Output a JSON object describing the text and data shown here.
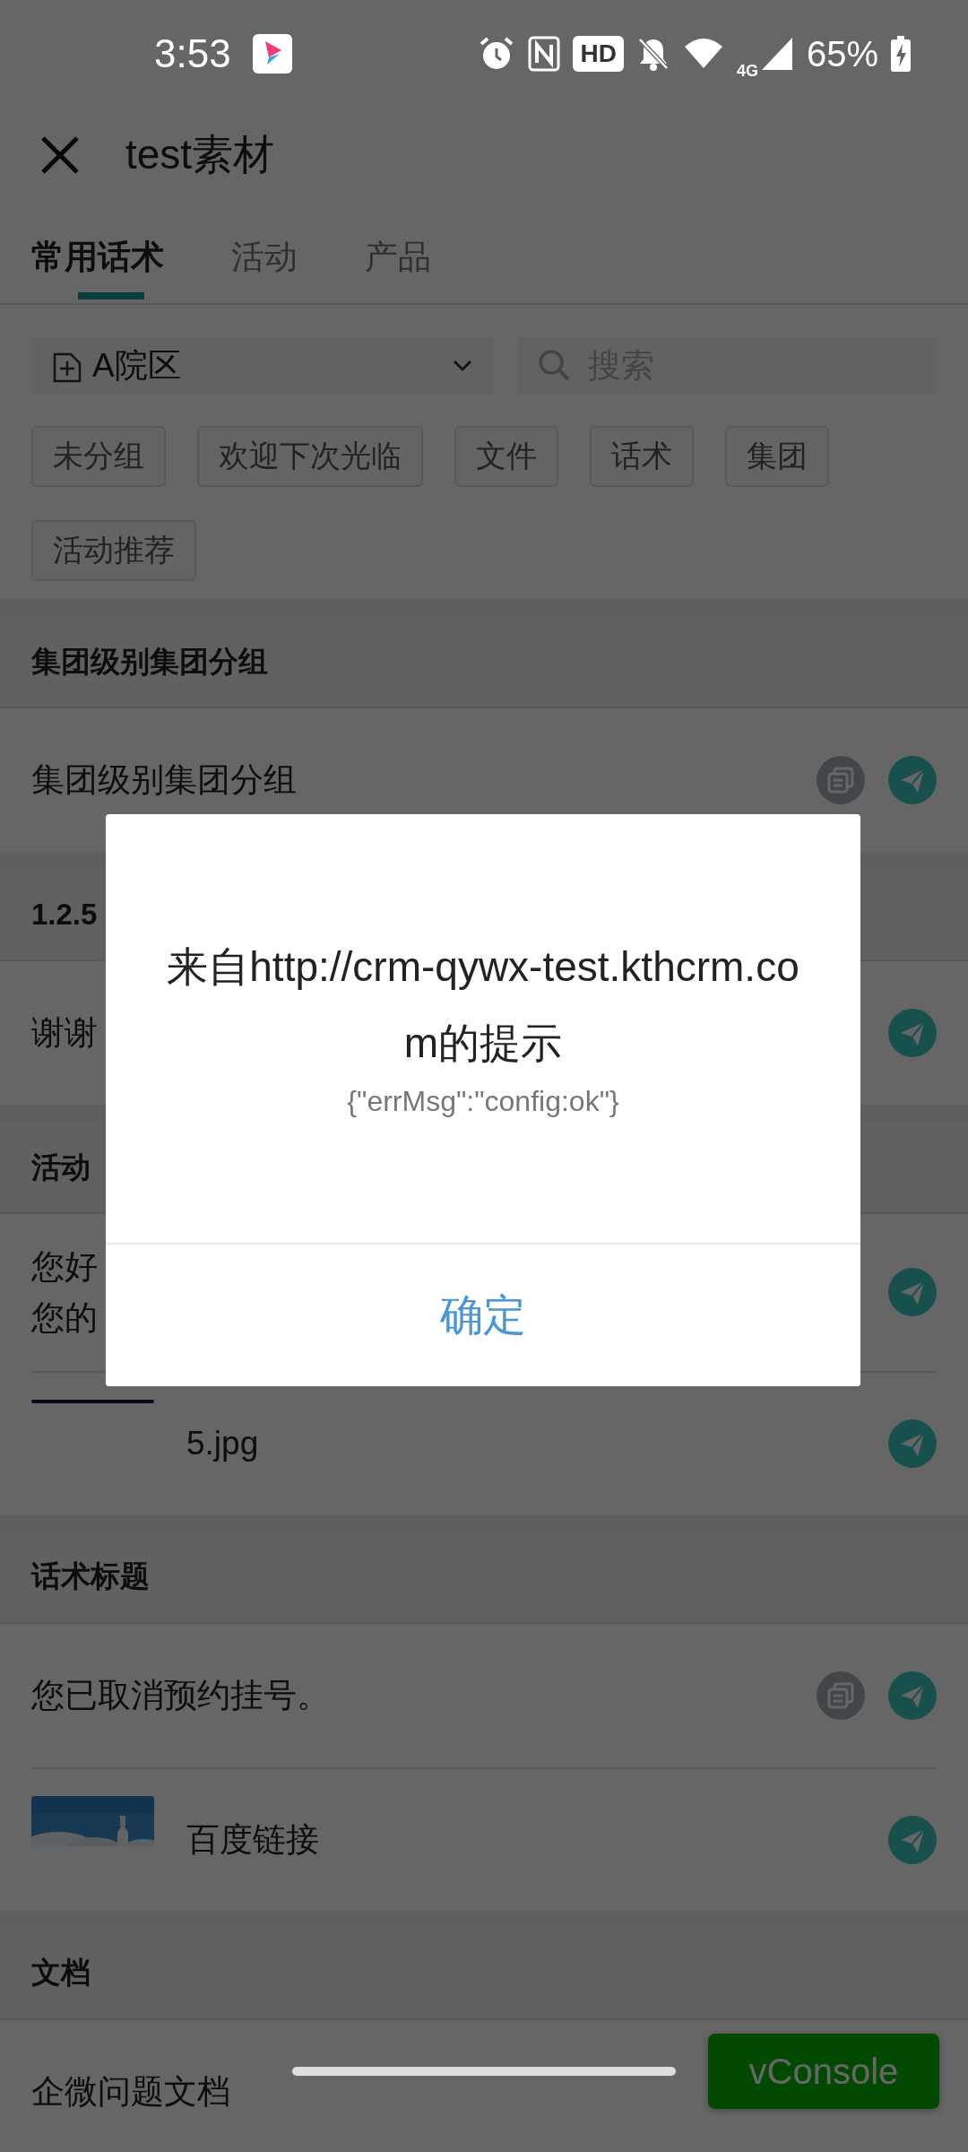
{
  "status_bar": {
    "time": "3:53",
    "hd_badge": "HD",
    "network": "4G",
    "battery": "65%"
  },
  "header": {
    "title": "test素材"
  },
  "tabs": [
    {
      "label": "常用话术",
      "selected": true
    },
    {
      "label": "活动",
      "selected": false
    },
    {
      "label": "产品",
      "selected": false
    }
  ],
  "campus_select": {
    "value": "A院区"
  },
  "search": {
    "placeholder": "搜索"
  },
  "tags": [
    "未分组",
    "欢迎下次光临",
    "文件",
    "话术",
    "集团",
    "活动推荐"
  ],
  "sections": [
    {
      "title": "集团级别集团分组",
      "rows": [
        {
          "kind": "text",
          "text": "集团级别集团分组",
          "copy": true,
          "send": true
        }
      ]
    },
    {
      "title": "1.2.5",
      "rows": [
        {
          "kind": "text",
          "text": "谢谢",
          "copy": false,
          "send": true
        }
      ]
    },
    {
      "title": "活动",
      "rows": [
        {
          "kind": "text",
          "lines": [
            "您好",
            "您的"
          ],
          "copy": false,
          "send": true
        },
        {
          "kind": "file",
          "text": "5.jpg",
          "copy": false,
          "send": true
        }
      ]
    },
    {
      "title": "话术标题",
      "rows": [
        {
          "kind": "text",
          "text": "您已取消预约挂号。",
          "copy": true,
          "send": true
        },
        {
          "kind": "link",
          "text": "百度链接",
          "copy": false,
          "send": true
        }
      ]
    },
    {
      "title": "文档",
      "rows": [
        {
          "kind": "text",
          "text": "企微问题文档",
          "copy": false,
          "send": false
        }
      ]
    }
  ],
  "vconsole": "vConsole",
  "dialog": {
    "title": "来自http://crm-qywx-test.kthcrm.com的提示",
    "message": "{\"errMsg\":\"config:ok\"}",
    "button": "确定"
  }
}
